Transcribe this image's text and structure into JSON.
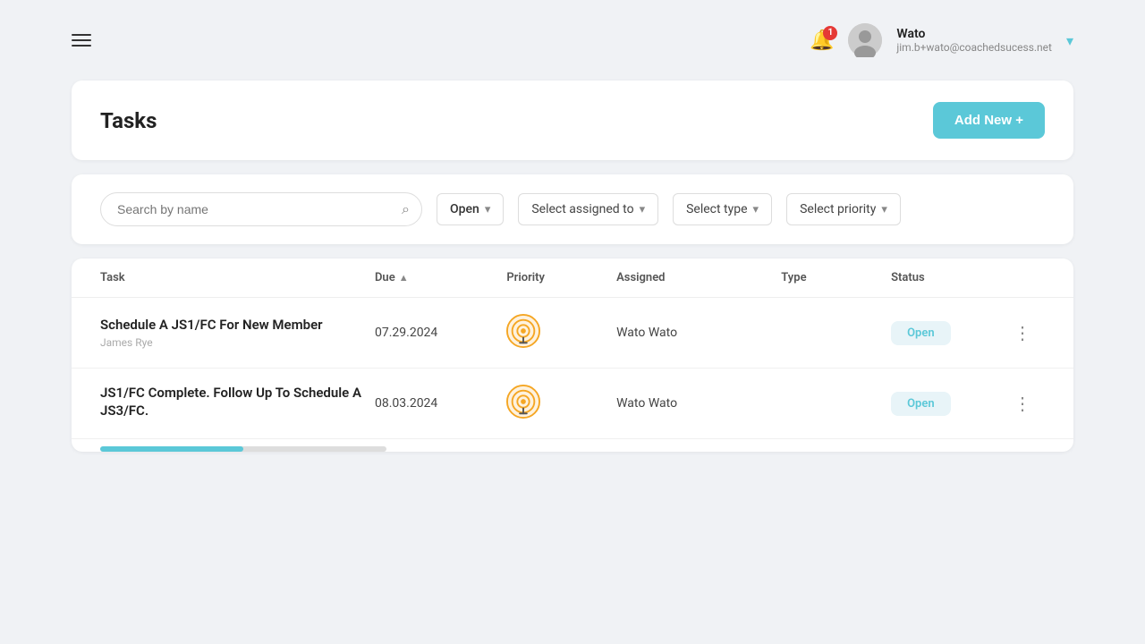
{
  "header": {
    "hamburger_label": "menu",
    "notification_count": "1",
    "user": {
      "name": "Wato",
      "email": "jim.b+wato@coachedsucess.net",
      "chevron": "▾"
    }
  },
  "page": {
    "title": "Tasks",
    "add_button": "Add New +"
  },
  "filters": {
    "search_placeholder": "Search by name",
    "status": {
      "value": "Open",
      "chevron": "▾"
    },
    "assigned": {
      "placeholder": "Select assigned to",
      "chevron": "▾"
    },
    "type": {
      "placeholder": "Select type",
      "chevron": "▾"
    },
    "priority": {
      "placeholder": "Select priority",
      "chevron": "▾"
    }
  },
  "table": {
    "columns": [
      {
        "label": "Task",
        "sort": ""
      },
      {
        "label": "Due",
        "sort": "▲"
      },
      {
        "label": "Priority",
        "sort": ""
      },
      {
        "label": "Assigned",
        "sort": ""
      },
      {
        "label": "Type",
        "sort": ""
      },
      {
        "label": "Status",
        "sort": ""
      },
      {
        "label": "",
        "sort": ""
      }
    ],
    "rows": [
      {
        "task_title": "Schedule A JS1/FC For New Member",
        "task_subtitle": "James Rye",
        "due_date": "07.29.2024",
        "assigned": "Wato Wato",
        "status": "Open"
      },
      {
        "task_title": "JS1/FC Complete. Follow Up To Schedule A JS3/FC.",
        "task_subtitle": "",
        "due_date": "08.03.2024",
        "assigned": "Wato Wato",
        "status": "Open"
      }
    ]
  }
}
